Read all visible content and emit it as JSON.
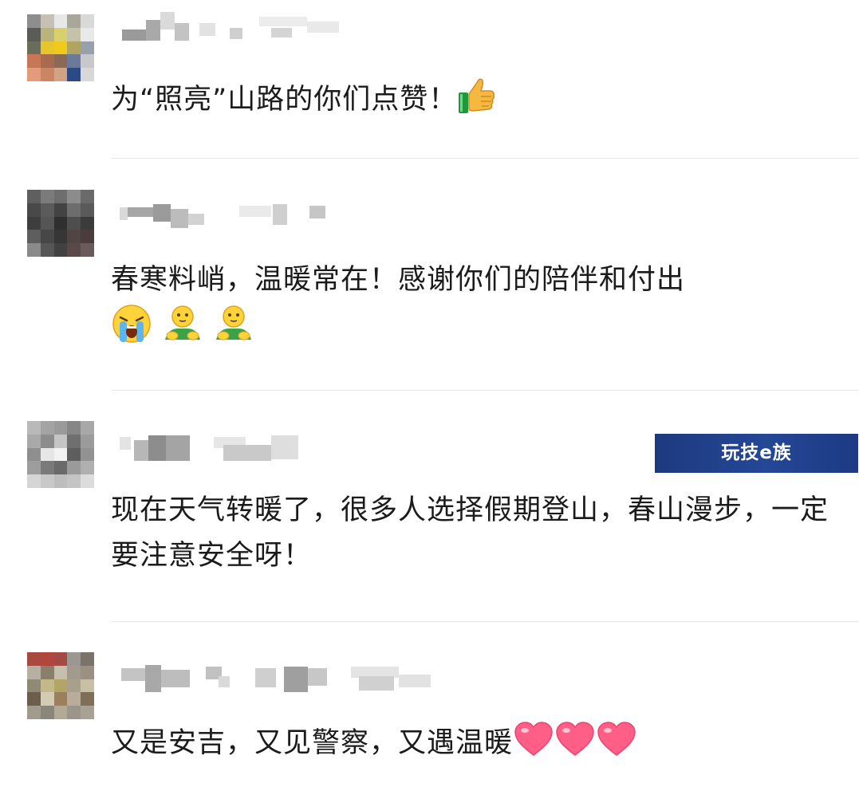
{
  "comments": [
    {
      "text": "为“照亮”山路的你们点赞！",
      "emoji": [
        "thumbs-up"
      ]
    },
    {
      "text": "春寒料峭，温暖常在！感谢你们的陪伴和付出",
      "emoji": [
        "loudly-crying-face",
        "person-with-folded-hands",
        "person-with-folded-hands"
      ]
    },
    {
      "text": "现在天气转暖了，很多人选择假期登山，春山漫步，一定要注意安全呀！",
      "emoji": []
    },
    {
      "text": "又是安吉，又见警察，又遇温暖",
      "emoji": [
        "heart",
        "heart",
        "heart"
      ]
    }
  ],
  "watermark": {
    "text": "玩技e族"
  },
  "colors": {
    "text": "#1b1b1b",
    "divider": "#e6e6e6",
    "watermark_bg": "#244796"
  }
}
